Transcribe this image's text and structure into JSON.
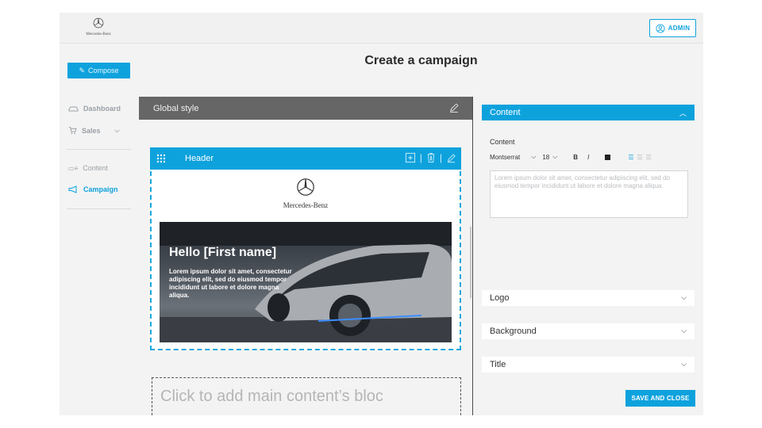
{
  "header": {
    "brand_text": "Mercedes-Benz",
    "admin_label": "ADMIN"
  },
  "sidebar": {
    "compose_label": "Compose",
    "items": [
      {
        "label": "Dashboard",
        "icon": "car-icon"
      },
      {
        "label": "Sales",
        "icon": "cart-icon"
      },
      {
        "label": "Content",
        "icon": "content-icon"
      },
      {
        "label": "Campaign",
        "icon": "megaphone-icon"
      }
    ]
  },
  "main": {
    "title": "Create a campaign",
    "global_style_label": "Global style",
    "header_block": {
      "label": "Header",
      "brand_text": "Mercedes-Benz",
      "hero_title": "Hello [First name]",
      "hero_body": "Lorem ipsum dolor sit amet, consectetur adipiscing elit, sed do eiusmod tempor incididunt ut labore et dolore magna aliqua."
    },
    "add_block_placeholder": "Click to add main content’s bloc"
  },
  "panel": {
    "content_section": "Content",
    "content_label": "Content",
    "font": "Montserrat",
    "size": "18",
    "bold": "B",
    "italic": "I",
    "text_placeholder": "Lorem ipsum dolor sit amet, consectetur adipiscing elit, sed do eiusmod tempor incididunt ut labore et dolore magna aliqua.",
    "sections": [
      "Logo",
      "Background",
      "Title"
    ],
    "save_label": "SAVE AND CLOSE"
  },
  "colors": {
    "accent": "#0ea2dd",
    "dark_bar": "#666666"
  }
}
